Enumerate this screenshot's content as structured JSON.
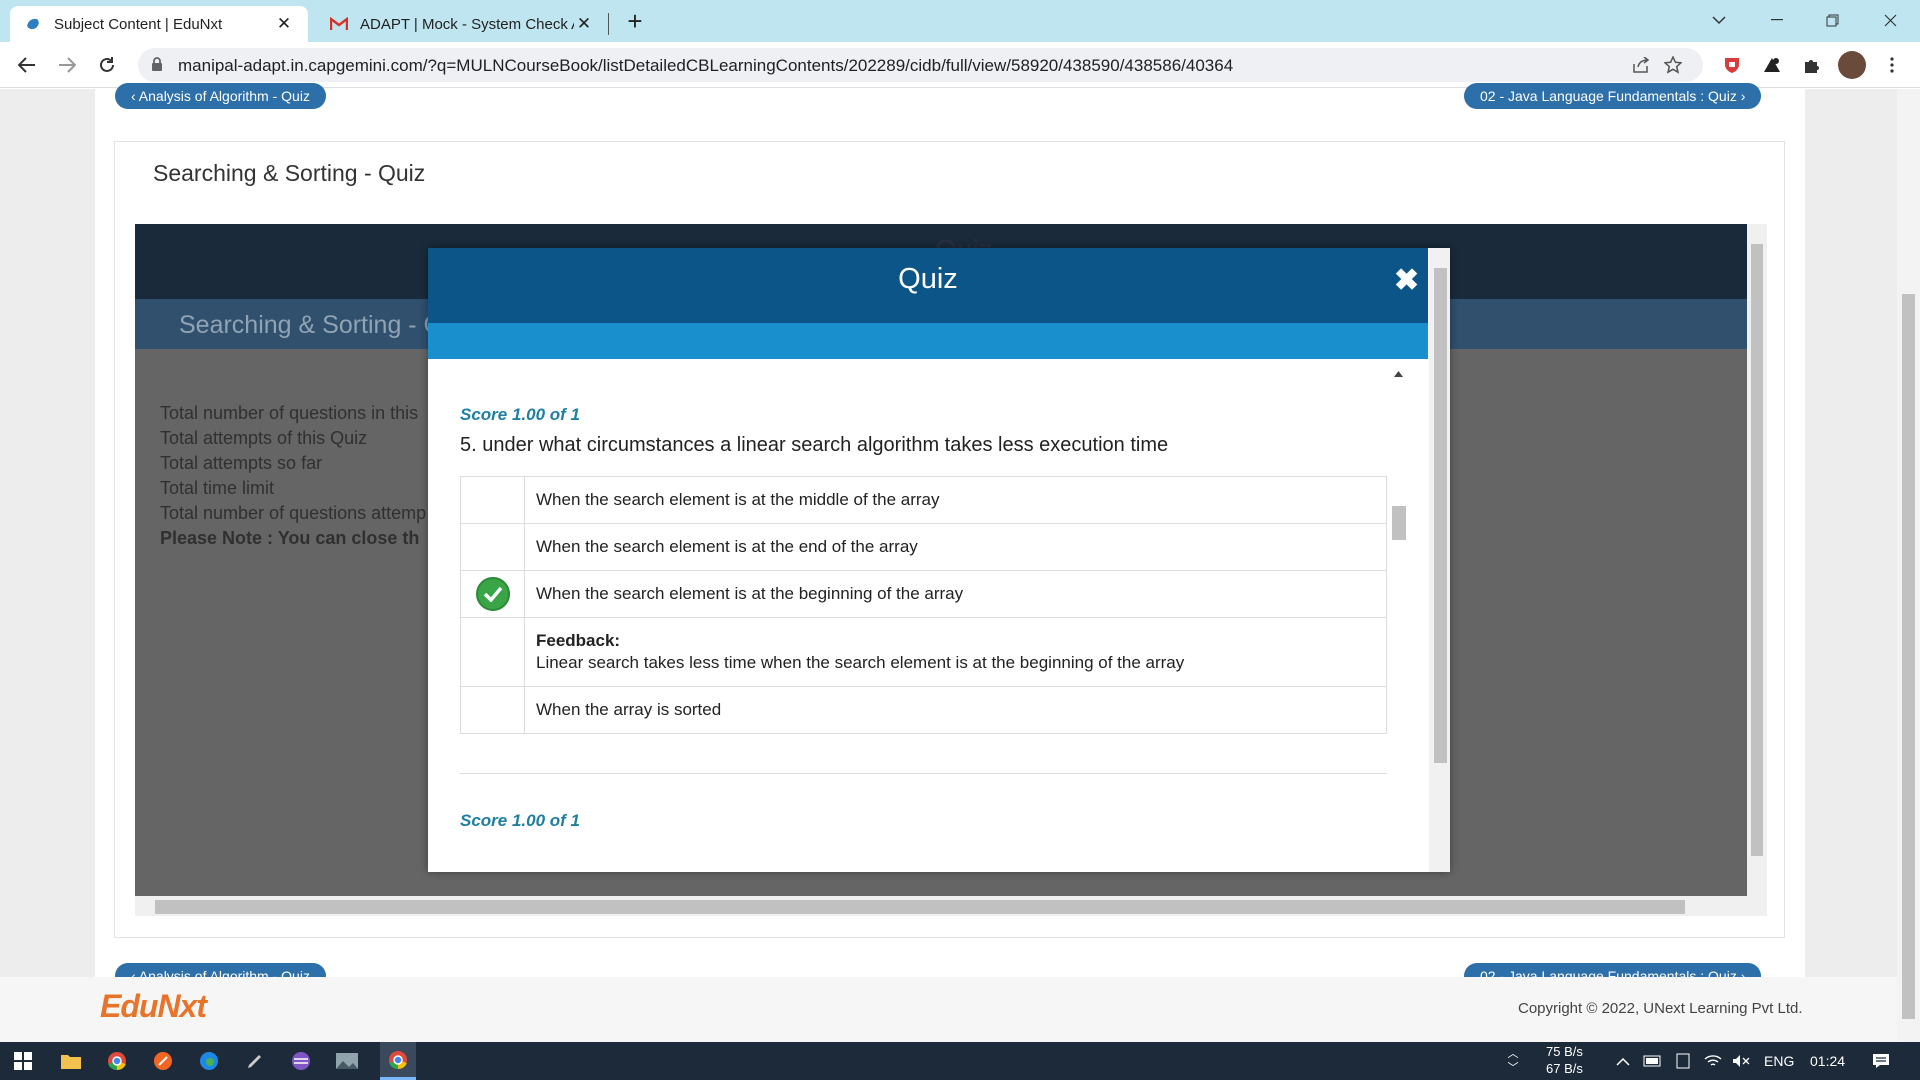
{
  "browser": {
    "tabs": [
      {
        "title": "Subject Content | EduNxt",
        "active": true
      },
      {
        "title": "ADAPT | Mock - System Check As",
        "active": false
      }
    ],
    "url": "manipal-adapt.in.capgemini.com/?q=MULNCourseBook/listDetailedCBLearningContents/202289/cidb/full/view/58920/438590/438586/40364"
  },
  "page": {
    "prev_link": "‹ Analysis of Algorithm - Quiz",
    "next_link": "02 - Java Language Fundamentals : Quiz ›",
    "card_title": "Searching & Sorting - Quiz",
    "scorm": {
      "header_text": "Quiz",
      "subtitle": "Searching & Sorting - Q",
      "info_lines": [
        "Total number of questions in this",
        "Total attempts of this Quiz",
        "Total attempts so far",
        "Total time limit",
        "Total number of questions attemp"
      ],
      "note": "Please Note : You can close th"
    }
  },
  "modal": {
    "title": "Quiz",
    "close": "✖",
    "score": "Score 1.00 of 1",
    "question": "5. under what circumstances a linear search algorithm takes less execution time",
    "options": [
      "When the search element is at the middle of the array",
      "When the search element is at the end of the array",
      "When the search element is at the beginning of the array",
      "When the array is sorted"
    ],
    "feedback_label": "Feedback:",
    "feedback_text": "Linear search takes less time when the search element is at the beginning of the array",
    "next_score": "Score 1.00 of 1"
  },
  "footer": {
    "logo": "EduNxt",
    "copyright": "Copyright © 2022, UNext Learning Pvt Ltd."
  },
  "taskbar": {
    "net_up": "75 B/s",
    "net_down": "67 B/s",
    "lang": "ENG",
    "time": "01:24"
  },
  "colors": {
    "modal_header": "#0b5589",
    "modal_band": "#1a8fcd",
    "nav_pill": "#2c6fa9",
    "score_text": "#1f7fa0",
    "correct_check": "#3aa547"
  }
}
